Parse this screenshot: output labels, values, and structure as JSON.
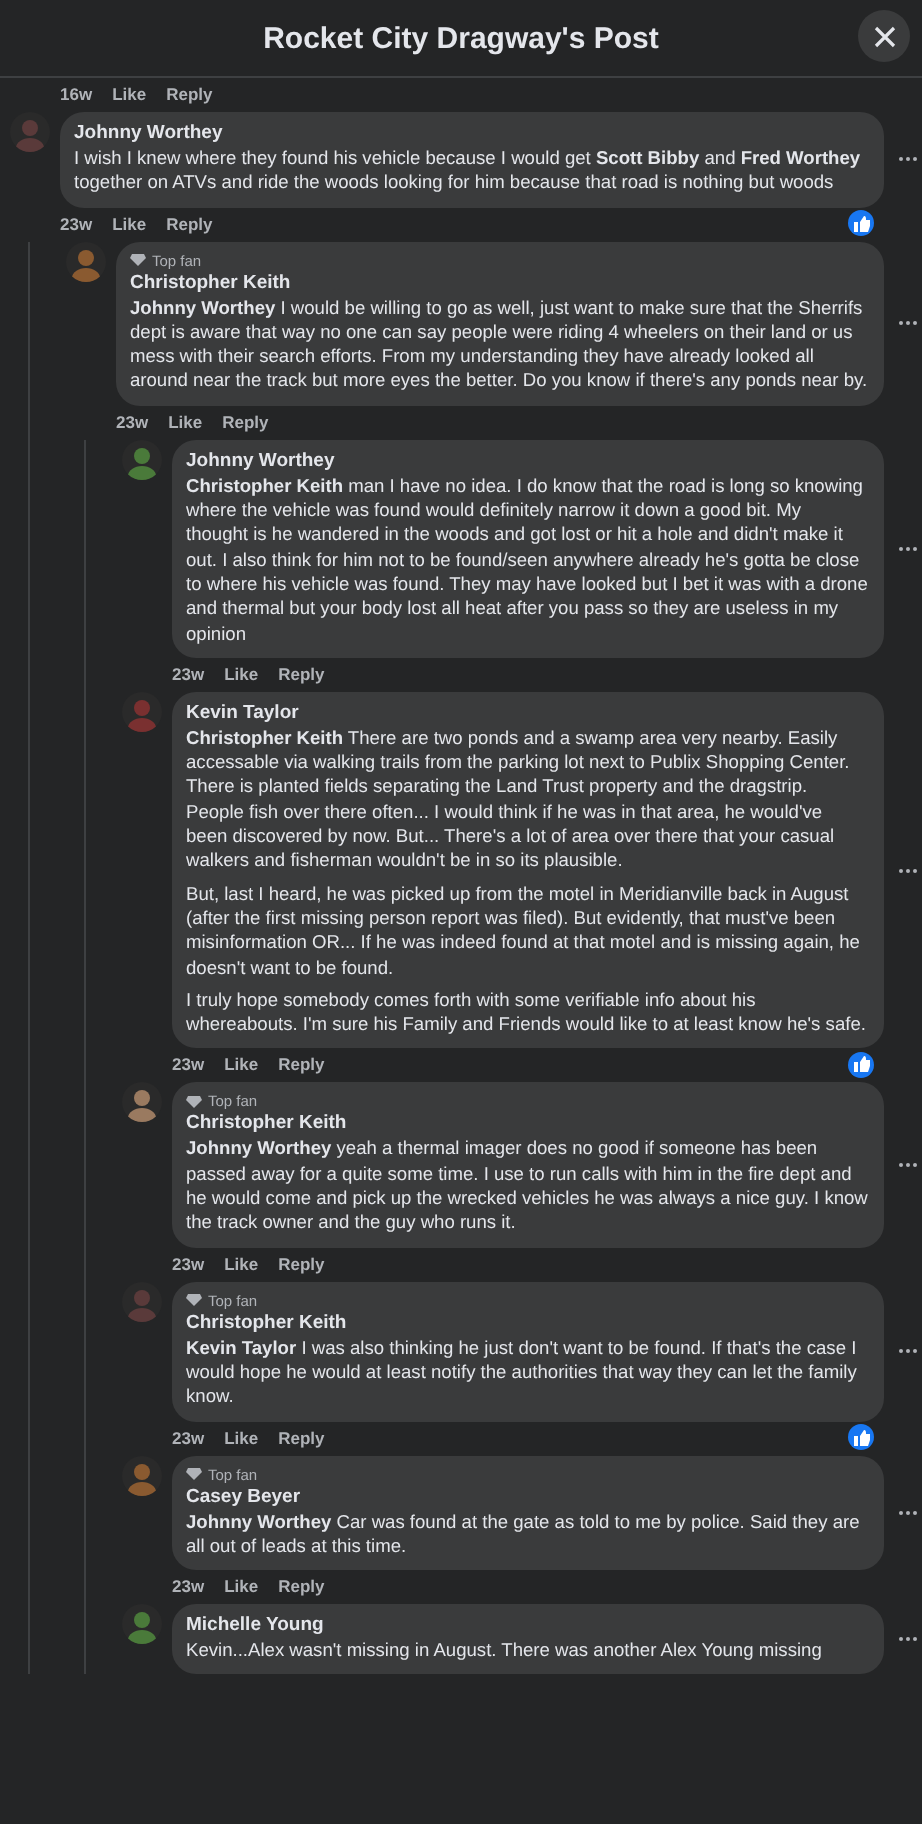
{
  "title": "Rocket City Dragway's Post",
  "top_actions": {
    "time": "16w",
    "like": "Like",
    "reply": "Reply"
  },
  "comments": [
    {
      "author": "Johnny Worthey",
      "top_fan": false,
      "paragraphs": [
        "I wish I knew where they found his vehicle because I would get **Scott Bibby** and **Fred Worthey** together on ATVs and ride the woods looking for him because that road is nothing but woods"
      ],
      "time": "23w",
      "like": "Like",
      "reply": "Reply",
      "liked": true,
      "children": [
        {
          "author": "Christopher Keith",
          "top_fan": true,
          "badge": "Top fan",
          "paragraphs": [
            "**Johnny Worthey** I would be willing to go as well, just want to make sure that the Sherrifs dept is aware that way no one can say people were riding 4 wheelers on their land or us mess with their search efforts. From my understanding they have already looked all around near the track but more eyes the better. Do you know if there's any ponds near by."
          ],
          "time": "23w",
          "like": "Like",
          "reply": "Reply",
          "liked": false,
          "children": [
            {
              "author": "Johnny Worthey",
              "top_fan": false,
              "paragraphs": [
                "**Christopher Keith** man I have no idea. I do know that the road is long so knowing where the vehicle was found would definitely narrow it down a good bit. My thought is he wandered in the woods and got lost or hit a hole and didn't make it out. I also think for him not to be found/seen anywhere already he's gotta be close to where his vehicle was found. They may have looked but I bet it was with a drone and thermal but your body lost all heat after you pass so they are useless in my opinion"
              ],
              "time": "23w",
              "like": "Like",
              "reply": "Reply",
              "liked": false
            },
            {
              "author": "Kevin Taylor",
              "top_fan": false,
              "paragraphs": [
                "**Christopher Keith** There are two ponds and a swamp area very nearby. Easily accessable via walking trails from the parking lot next to Publix Shopping Center. There is planted fields separating the Land Trust property and the dragstrip. People fish over there often... I would think if he was in that area, he would've been discovered by now. But... There's a lot of area over there that your casual walkers and fisherman wouldn't be in so its plausible.",
                "But, last I heard, he was picked up from the motel in Meridianville back in August (after the first missing person report was filed). But evidently, that must've been misinformation OR... If he was indeed found at that motel and is missing again, he doesn't want to be found.",
                "I truly hope somebody comes forth with some verifiable info about his whereabouts. I'm sure his Family and Friends would like to at least know he's safe."
              ],
              "time": "23w",
              "like": "Like",
              "reply": "Reply",
              "liked": true
            },
            {
              "author": "Christopher Keith",
              "top_fan": true,
              "badge": "Top fan",
              "paragraphs": [
                "**Johnny Worthey** yeah a thermal imager does no good if someone has been passed away for a quite some time. I use to run calls with him in the fire dept and he would come and pick up the wrecked vehicles he was always a nice guy. I know the track owner and the guy who runs it."
              ],
              "time": "23w",
              "like": "Like",
              "reply": "Reply",
              "liked": false
            },
            {
              "author": "Christopher Keith",
              "top_fan": true,
              "badge": "Top fan",
              "paragraphs": [
                "**Kevin Taylor** I was also thinking he just don't want to be found. If that's the case I would hope he would at least notify the authorities that way they can let the family know."
              ],
              "time": "23w",
              "like": "Like",
              "reply": "Reply",
              "liked": true
            },
            {
              "author": "Casey Beyer",
              "top_fan": true,
              "badge": "Top fan",
              "paragraphs": [
                "**Johnny Worthey** Car was found at the gate as told to me by police. Said they are all out of leads at this time."
              ],
              "time": "23w",
              "like": "Like",
              "reply": "Reply",
              "liked": false
            },
            {
              "author": "Michelle Young",
              "top_fan": false,
              "paragraphs": [
                "Kevin...Alex wasn't missing in August. There was another Alex Young missing"
              ]
            }
          ]
        }
      ]
    }
  ]
}
